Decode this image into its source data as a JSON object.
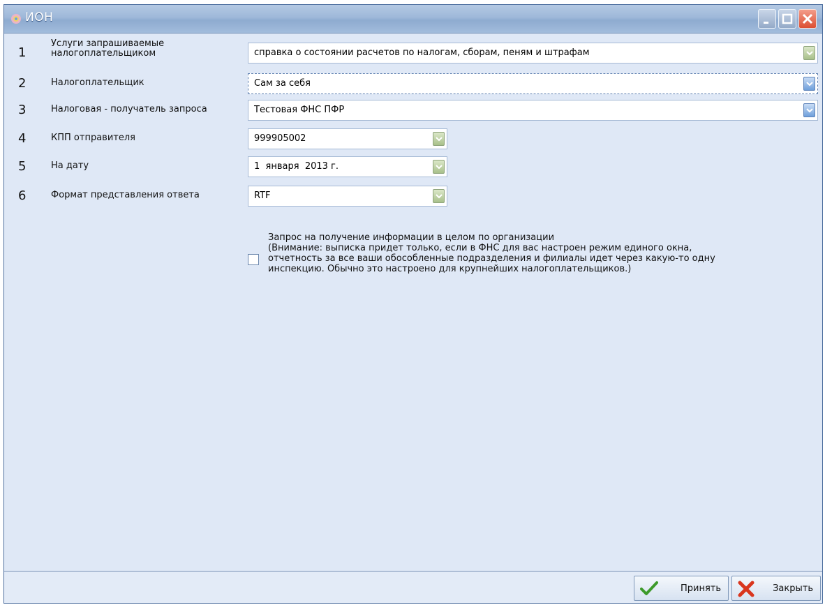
{
  "window": {
    "title": "ИОН"
  },
  "form": {
    "rows": [
      {
        "num": "1",
        "label_line1": "Услуги запрашиваемые",
        "label_line2": "налогоплательщиком",
        "value": "справка о состоянии расчетов по налогам, сборам, пеням и штрафам"
      },
      {
        "num": "2",
        "label": "Налогоплательщик",
        "value": "Сам за себя"
      },
      {
        "num": "3",
        "label": "Налоговая - получатель запроса",
        "value": "Тестовая ФНС ПФР"
      },
      {
        "num": "4",
        "label": "КПП отправителя",
        "value": "999905002"
      },
      {
        "num": "5",
        "label": "На дату",
        "value": "1  января  2013 г."
      },
      {
        "num": "6",
        "label": "Формат представления ответа",
        "value": "RTF"
      }
    ],
    "checkbox": {
      "checked": false,
      "line1": "Запрос на получение информации в целом по организации",
      "line2": "(Внимание: выписка придет только, если в ФНС для вас настроен режим единого окна,",
      "line3": "отчетность за все ваши обособленные подразделения и филиалы идет через какую-то одну",
      "line4": "инспекцию. Обычно это настроено для крупнейших налогоплательщиков.)"
    }
  },
  "buttons": {
    "accept": "Принять",
    "close": "Закрыть"
  },
  "colors": {
    "accent": "#9eb8d9",
    "background": "#dfe8f6"
  }
}
